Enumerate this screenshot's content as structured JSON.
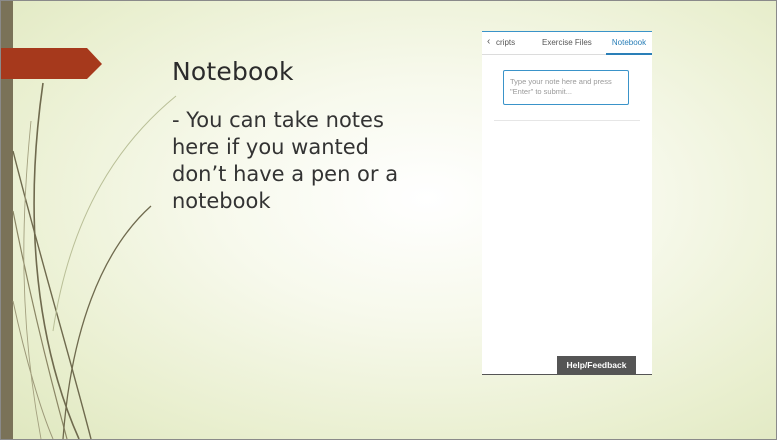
{
  "slide": {
    "title": "Notebook",
    "body": "- You can take notes here if you wanted don’t have a pen or a notebook"
  },
  "panel": {
    "tabs": [
      "Transcripts",
      "Exercise Files",
      "Notebook"
    ],
    "tab_transcripts_visible": "cripts",
    "active_tab": "Notebook",
    "note_input": {
      "value": "",
      "placeholder": "Type your note here and press \"Enter\" to submit..."
    },
    "help_button_label": "Help/Feedback"
  },
  "icons": {
    "prev": "chevron-left-icon"
  },
  "colors": {
    "accent_arrow": "#a6391c",
    "left_bar": "#7a7258",
    "active_tab": "#2a7fb8",
    "help_button_bg": "#555555"
  }
}
